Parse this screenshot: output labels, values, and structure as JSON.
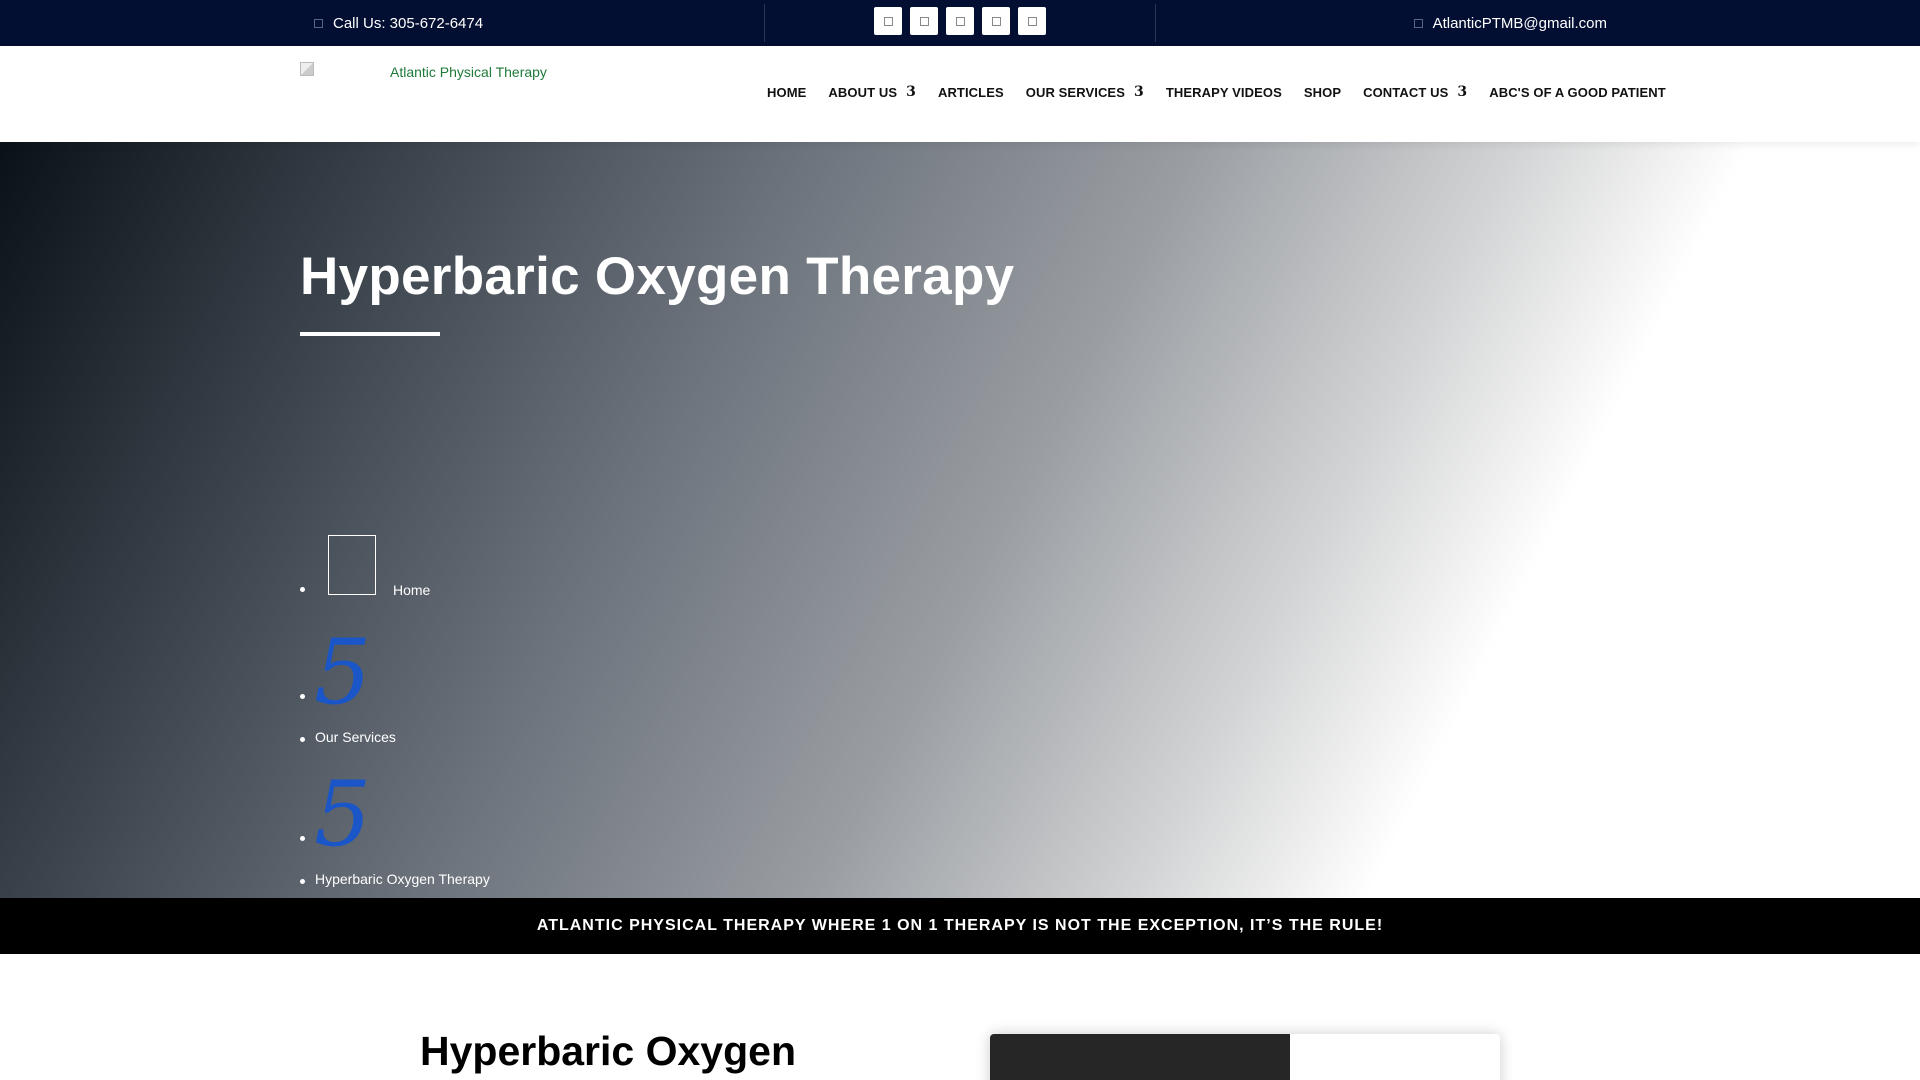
{
  "topbar": {
    "phone": "Call Us: 305-672-6474",
    "email": "AtlanticPTMB@gmail.com",
    "socials": [
      "facebook-icon",
      "twitter-icon",
      "instagram-icon",
      "youtube-icon",
      "linkedin-icon"
    ]
  },
  "header": {
    "logo_alt": "Atlantic Physical Therapy",
    "nav": [
      {
        "label": "HOME",
        "has_caret": false
      },
      {
        "label": "ABOUT US",
        "has_caret": true
      },
      {
        "label": "ARTICLES",
        "has_caret": false
      },
      {
        "label": "OUR SERVICES",
        "has_caret": true
      },
      {
        "label": "THERAPY VIDEOS",
        "has_caret": false
      },
      {
        "label": "SHOP",
        "has_caret": false
      },
      {
        "label": "CONTACT US",
        "has_caret": true
      },
      {
        "label": "ABC'S OF A GOOD PATIENT",
        "has_caret": false
      }
    ],
    "caret_glyph": "3"
  },
  "hero": {
    "title": "Hyperbaric Oxygen Therapy",
    "breadcrumb": {
      "home": "Home",
      "separator": "5",
      "parent": "Our Services",
      "current": "Hyperbaric Oxygen Therapy"
    }
  },
  "tagline": "ATLANTIC PHYSICAL THERAPY WHERE 1 ON 1 THERAPY IS NOT THE EXCEPTION, IT’S THE RULE!",
  "content": {
    "title": "Hyperbaric Oxygen"
  },
  "colors": {
    "topbar_bg": "#030f32",
    "separator": "#1a56c8",
    "logo_text": "#1f7a3a"
  }
}
